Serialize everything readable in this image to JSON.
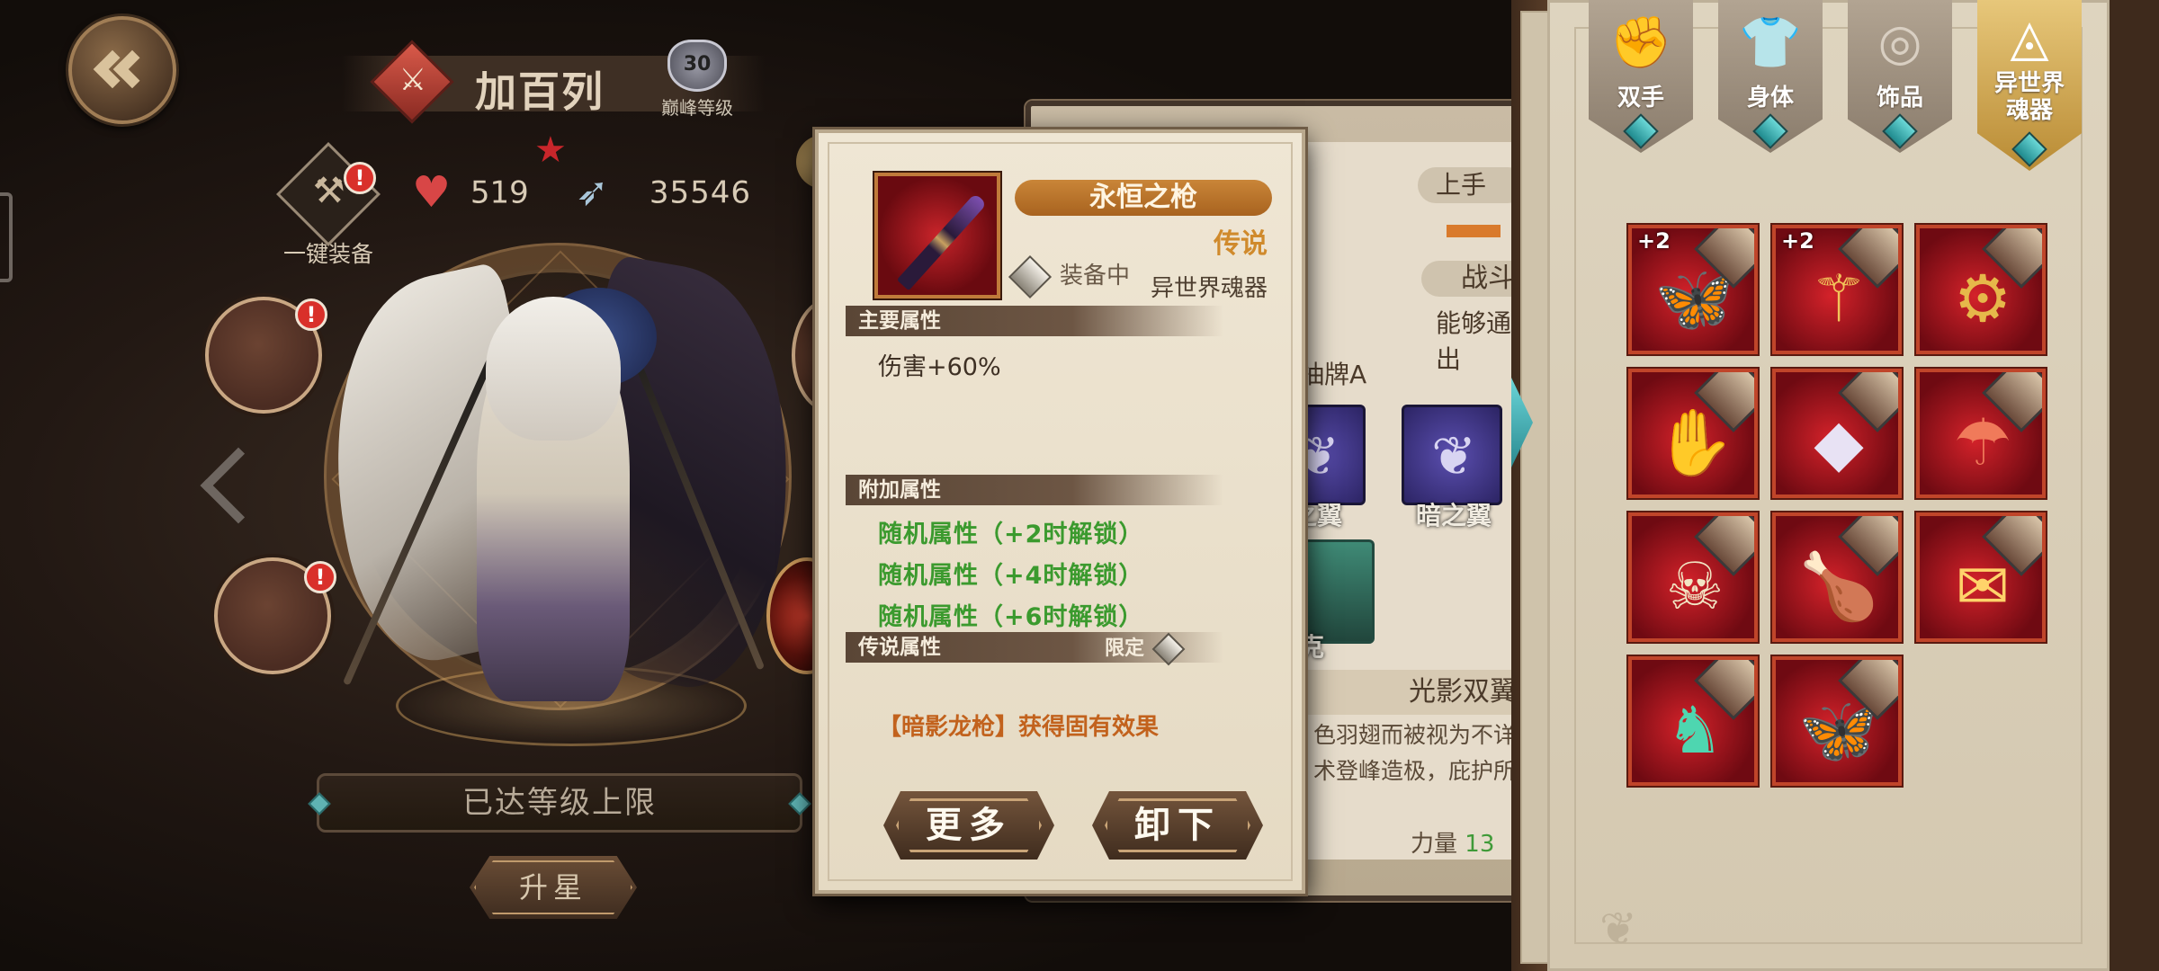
{
  "hero": {
    "name": "加百列",
    "peak_level": "30",
    "peak_level_label": "巅峰等级",
    "star_count": 1,
    "equip_all_label": "一键装备",
    "equip_all_alert": "!",
    "hp_stat": "519",
    "power_stat": "35546",
    "level_cap_label": "已达等级上限",
    "star_up_label": "升星"
  },
  "empty_slots": [
    {
      "alert": "!"
    },
    {
      "alert": "!"
    }
  ],
  "stats_panel": {
    "top_label": "上手",
    "battle_label": "战斗",
    "desc_text": "能够通出",
    "card_a_label": "抽牌A",
    "wing_cards": [
      "之翼",
      "暗之翼"
    ],
    "portrait_label": "克",
    "light_wing_title": "光影双翼",
    "lore_text": "色羽翅而被视为不详术登峰造极，庇护所",
    "strength_label": "力量",
    "strength_value": "13"
  },
  "item_card": {
    "name": "永恒之枪",
    "rarity": "传说",
    "equipped_label": "装备中",
    "type": "异世界魂器",
    "main_attr_title": "主要属性",
    "main_attr_value": "伤害+60%",
    "extra_attr_title": "附加属性",
    "extra_attrs": [
      "随机属性（+2时解锁）",
      "随机属性（+4时解锁）",
      "随机属性（+6时解锁）"
    ],
    "legend_attr_title": "传说属性",
    "limited_label": "限定",
    "legend_effect": "【暗影龙枪】获得固有效果",
    "more_button": "更多",
    "unequip_button": "卸下",
    "rarity_color": "#d08a2c",
    "bonus_color": "#3b9a2e"
  },
  "inventory": {
    "tabs": [
      {
        "label": "双手",
        "icon": "gauntlet-icon",
        "active": false
      },
      {
        "label": "身体",
        "icon": "armor-icon",
        "active": false
      },
      {
        "label": "饰品",
        "icon": "ring-icon",
        "active": false
      },
      {
        "label": "异世界魂器",
        "label_line1": "异世界",
        "label_line2": "魂器",
        "icon": "eye-triangle-icon",
        "active": true
      }
    ],
    "items": [
      {
        "plus": "+2",
        "art": "butterfly-wings-icon"
      },
      {
        "plus": "+2",
        "art": "golden-scepter-icon"
      },
      {
        "plus": "",
        "art": "gatling-gun-icon"
      },
      {
        "plus": "",
        "art": "claw-gauntlet-icon"
      },
      {
        "plus": "",
        "art": "crimson-boot-icon"
      },
      {
        "plus": "",
        "art": "red-umbrella-icon"
      },
      {
        "plus": "",
        "art": "skull-armor-icon"
      },
      {
        "plus": "",
        "art": "roast-meat-icon"
      },
      {
        "plus": "",
        "art": "red-envelope-icon"
      },
      {
        "plus": "",
        "art": "jade-statue-icon"
      },
      {
        "plus": "",
        "art": "pink-butterfly-icon"
      }
    ]
  }
}
